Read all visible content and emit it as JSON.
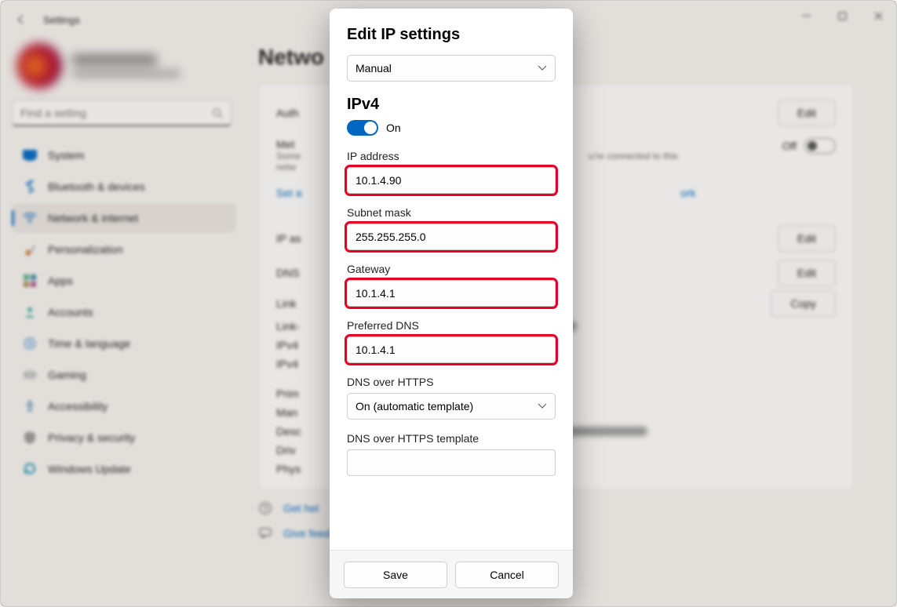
{
  "window": {
    "title": "Settings"
  },
  "search": {
    "placeholder": "Find a setting"
  },
  "nav": {
    "items": [
      {
        "label": "System"
      },
      {
        "label": "Bluetooth & devices"
      },
      {
        "label": "Network & internet"
      },
      {
        "label": "Personalization"
      },
      {
        "label": "Apps"
      },
      {
        "label": "Accounts"
      },
      {
        "label": "Time & language"
      },
      {
        "label": "Gaming"
      },
      {
        "label": "Accessibility"
      },
      {
        "label": "Privacy & security"
      },
      {
        "label": "Windows Update"
      }
    ]
  },
  "main": {
    "heading": "Netwo",
    "rows": {
      "auth": {
        "label": "Auth",
        "button": "Edit"
      },
      "metered": {
        "label": "Met",
        "desc_a": "Some",
        "desc_b": "netw",
        "desc_c": "u're connected to this",
        "off": "Off"
      },
      "set_link": "Set a",
      "ip_assign": {
        "label": "IP as",
        "button": "Edit"
      },
      "dns": {
        "label": "DNS",
        "button": "Edit"
      },
      "link1": "Link",
      "link2": "Link-",
      "ipv4a": "IPv4",
      "ipv4b": "IPv4",
      "copy": "Copy",
      "prim": "Prim",
      "man": "Man",
      "desc": "Desc",
      "driv": "Driv",
      "phys": "Phys",
      "link_right": "ork"
    },
    "help": {
      "get": "Get hel",
      "give": "Give feed"
    }
  },
  "modal": {
    "title": "Edit IP settings",
    "mode": "Manual",
    "ipv4_heading": "IPv4",
    "toggle_label": "On",
    "fields": {
      "ip": {
        "label": "IP address",
        "value": "10.1.4.90"
      },
      "mask": {
        "label": "Subnet mask",
        "value": "255.255.255.0"
      },
      "gateway": {
        "label": "Gateway",
        "value": "10.1.4.1"
      },
      "pdns": {
        "label": "Preferred DNS",
        "value": "10.1.4.1"
      },
      "doh": {
        "label": "DNS over HTTPS",
        "value": "On (automatic template)"
      },
      "doh_tpl": {
        "label": "DNS over HTTPS template",
        "value": ""
      }
    },
    "save": "Save",
    "cancel": "Cancel"
  }
}
